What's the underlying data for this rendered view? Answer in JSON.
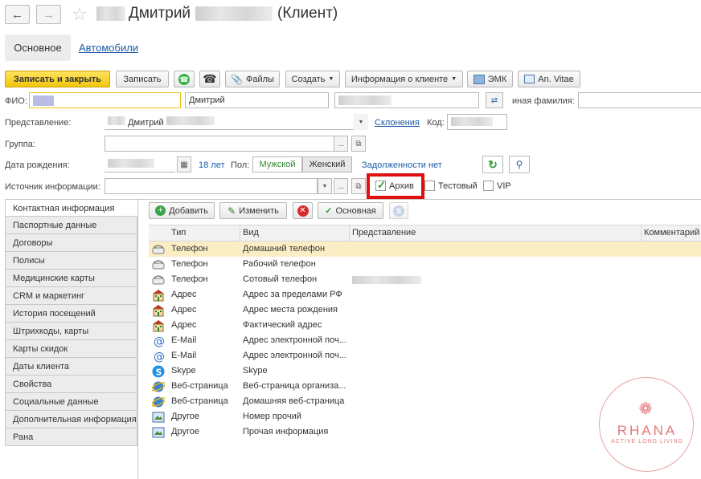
{
  "window": {
    "title_name": "Дмитрий",
    "title_suffix": "(Клиент)"
  },
  "tabs": {
    "main": "Основное",
    "cars": "Автомобили"
  },
  "toolbar": {
    "save_close": "Записать и закрыть",
    "save": "Записать",
    "files": "Файлы",
    "create": "Создать",
    "client_info": "Информация о клиенте",
    "emk": "ЭМК",
    "an_vitae": "An. Vitae"
  },
  "form": {
    "fio_label": "ФИО:",
    "first_name": "Дмитрий",
    "other_surname_label": "иная фамилия:",
    "repr_label": "Представление:",
    "repr_value": "Дмитрий",
    "declension_link": "Склонения",
    "code_label": "Код:",
    "group_label": "Группа:",
    "dob_label": "Дата рождения:",
    "age": "18 лет",
    "sex_label": "Пол:",
    "male": "Мужской",
    "female": "Женский",
    "debts": "Задолженности нет",
    "source_label": "Источник информации:",
    "archive": "Архив",
    "test": "Тестовый",
    "vip": "VIP"
  },
  "sidebar": {
    "items": [
      "Контактная информация",
      "Паспортные данные",
      "Договоры",
      "Полисы",
      "Медицинские карты",
      "CRM и маркетинг",
      "История посещений",
      "Штрихкоды, карты",
      "Карты скидок",
      "Даты клиента",
      "Свойства",
      "Социальные данные",
      "Дополнительная информация",
      "Рана"
    ]
  },
  "contacts_toolbar": {
    "add": "Добавить",
    "edit": "Изменить",
    "main": "Основная"
  },
  "table": {
    "headers": [
      "Тип",
      "Вид",
      "Представление",
      "Комментарий"
    ],
    "rows": [
      {
        "type": "Телефон",
        "kind": "Домашний телефон",
        "icon": "phone-icon"
      },
      {
        "type": "Телефон",
        "kind": "Рабочий телефон",
        "icon": "phone-icon"
      },
      {
        "type": "Телефон",
        "kind": "Сотовый телефон",
        "icon": "phone-icon"
      },
      {
        "type": "Адрес",
        "kind": "Адрес за пределами РФ",
        "icon": "building-icon"
      },
      {
        "type": "Адрес",
        "kind": "Адрес места рождения",
        "icon": "building-icon"
      },
      {
        "type": "Адрес",
        "kind": "Фактический адрес",
        "icon": "building-icon"
      },
      {
        "type": "E-Mail",
        "kind": "Адрес электронной поч...",
        "icon": "at-icon"
      },
      {
        "type": "E-Mail",
        "kind": "Адрес электронной поч...",
        "icon": "at-icon"
      },
      {
        "type": "Skype",
        "kind": "Skype",
        "icon": "skype-icon"
      },
      {
        "type": "Веб-страница",
        "kind": "Веб-страница организа...",
        "icon": "globe-icon"
      },
      {
        "type": "Веб-страница",
        "kind": "Домашняя веб-страница",
        "icon": "globe-icon"
      },
      {
        "type": "Другое",
        "kind": "Номер прочий",
        "icon": "note-icon"
      },
      {
        "type": "Другое",
        "kind": "Прочая информация",
        "icon": "note-icon"
      }
    ]
  },
  "watermark": {
    "brand": "RHANA",
    "tagline": "ACTIVE LONG LIVING"
  },
  "colors": {
    "accent_yellow": "#f5cc1a",
    "link_blue": "#1a5aa6",
    "selected_row": "#fbeec5",
    "highlight_red": "#e01010",
    "watermark_red": "#e8787a"
  }
}
